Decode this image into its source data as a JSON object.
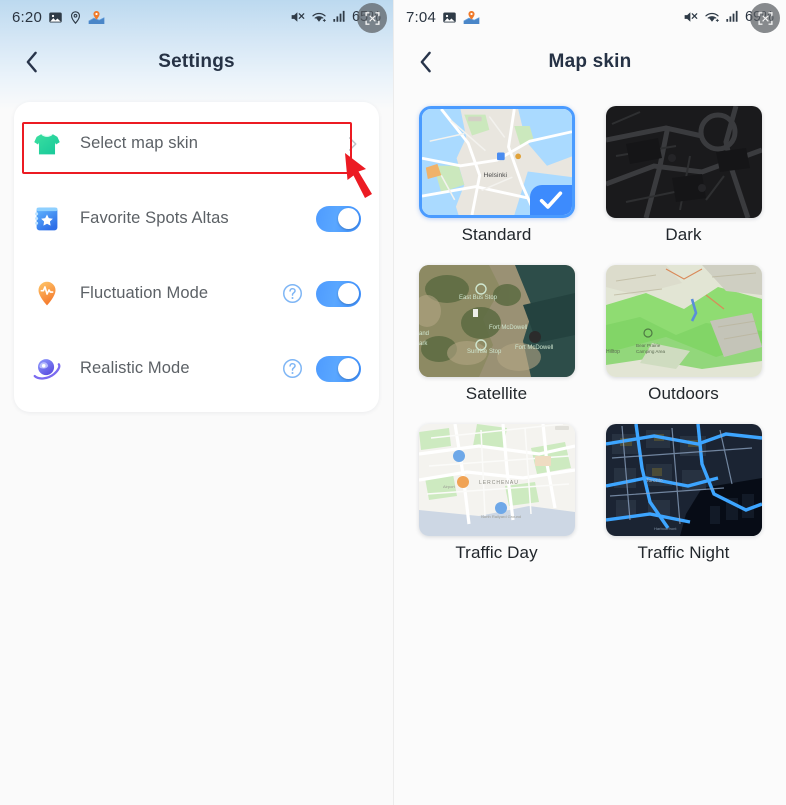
{
  "left_panel": {
    "status_bar": {
      "time": "6:20",
      "battery": "65%",
      "icons_left": [
        "image-icon",
        "location-pin-icon",
        "map-marker-icon"
      ],
      "icons_right": [
        "mute-icon",
        "wifi-icon",
        "signal-icon"
      ],
      "float_bubble_icon": "screen-capture-icon"
    },
    "appbar": {
      "back_icon": "chevron-left-icon",
      "title": "Settings"
    },
    "rows": [
      {
        "icon": "tshirt-icon",
        "label": "Select map skin",
        "control": "chevron",
        "help": false,
        "highlighted": true
      },
      {
        "icon": "favorite-book-icon",
        "label": "Favorite Spots Altas",
        "control": "toggle",
        "toggle_on": true,
        "help": false,
        "highlighted": false
      },
      {
        "icon": "fluctuation-pin-icon",
        "label": "Fluctuation Mode",
        "control": "toggle",
        "toggle_on": true,
        "help": true,
        "highlighted": false
      },
      {
        "icon": "planet-icon",
        "label": "Realistic Mode",
        "control": "toggle",
        "toggle_on": true,
        "help": true,
        "highlighted": false
      }
    ],
    "annotation": {
      "box_color": "#ec1b23",
      "arrow_color": "#ec1b23",
      "arrow_target": "Select map skin"
    }
  },
  "right_panel": {
    "status_bar": {
      "time": "7:04",
      "battery": "69%",
      "icons_left": [
        "image-icon",
        "map-marker-icon"
      ],
      "icons_right": [
        "mute-icon",
        "wifi-icon",
        "signal-icon"
      ],
      "float_bubble_icon": "screen-capture-icon"
    },
    "appbar": {
      "back_icon": "chevron-left-icon",
      "title": "Map skin"
    },
    "skins": [
      {
        "label": "Standard",
        "selected": true,
        "style": "standard"
      },
      {
        "label": "Dark",
        "selected": false,
        "style": "dark"
      },
      {
        "label": "Satellite",
        "selected": false,
        "style": "satellite"
      },
      {
        "label": "Outdoors",
        "selected": false,
        "style": "outdoors"
      },
      {
        "label": "Traffic Day",
        "selected": false,
        "style": "traffic_day"
      },
      {
        "label": "Traffic Night",
        "selected": false,
        "style": "traffic_night"
      }
    ],
    "selected_badge_icon": "check-icon",
    "accent_color": "#3d8bfd"
  }
}
